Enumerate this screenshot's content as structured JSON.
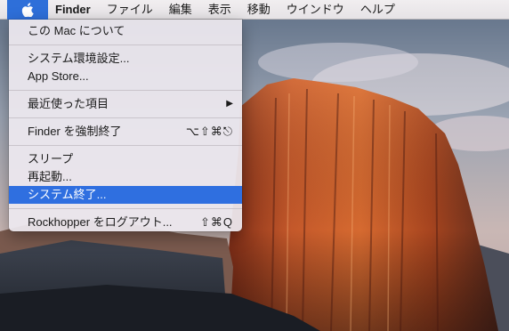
{
  "menubar": {
    "apple_icon": "apple-icon",
    "app_name": "Finder",
    "items": [
      "ファイル",
      "編集",
      "表示",
      "移動",
      "ウインドウ",
      "ヘルプ"
    ]
  },
  "apple_menu": {
    "about": "この Mac について",
    "system_preferences": "システム環境設定...",
    "app_store": "App Store...",
    "recent_items": "最近使った項目",
    "force_quit": "Finder を強制終了",
    "force_quit_shortcut": "⌥⇧⌘⎋",
    "sleep": "スリープ",
    "restart": "再起動...",
    "shut_down": "システム終了...",
    "log_out": "Rockhopper をログアウト...",
    "log_out_shortcut": "⇧⌘Q",
    "submenu_arrow": "▶"
  },
  "colors": {
    "highlight": "#2f6fe0",
    "apple_menu_active": "#2e6fd9"
  }
}
